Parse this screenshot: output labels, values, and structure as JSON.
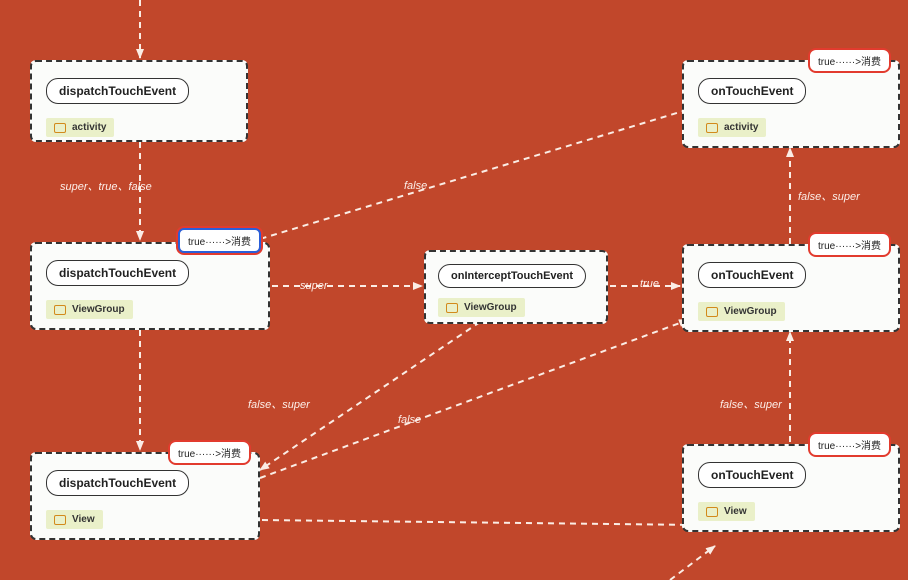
{
  "nodes": {
    "n1": {
      "title": "dispatchTouchEvent",
      "sub": "activity"
    },
    "n2": {
      "title": "dispatchTouchEvent",
      "sub": "ViewGroup"
    },
    "n3": {
      "title": "dispatchTouchEvent",
      "sub": "View"
    },
    "n4": {
      "title": "onInterceptTouchEvent",
      "sub": "ViewGroup"
    },
    "n5": {
      "title": "onTouchEvent",
      "sub": "activity"
    },
    "n6": {
      "title": "onTouchEvent",
      "sub": "ViewGroup"
    },
    "n7": {
      "title": "onTouchEvent",
      "sub": "View"
    }
  },
  "badges": {
    "b2": "true······>消费",
    "b3": "true······>消费",
    "b5": "true······>消费",
    "b6": "true······>消费",
    "b7": "true······>消费"
  },
  "edgeLabels": {
    "e_n1_n2": "super、true、false",
    "e_n2_n4": "super",
    "e_n4_n6": "true",
    "e_n2_n3": "false、super",
    "e_n4_n3": "false",
    "e_n6_n5": "false、super",
    "e_n7_n6": "false、super",
    "e_n2_n5_false": "false"
  }
}
